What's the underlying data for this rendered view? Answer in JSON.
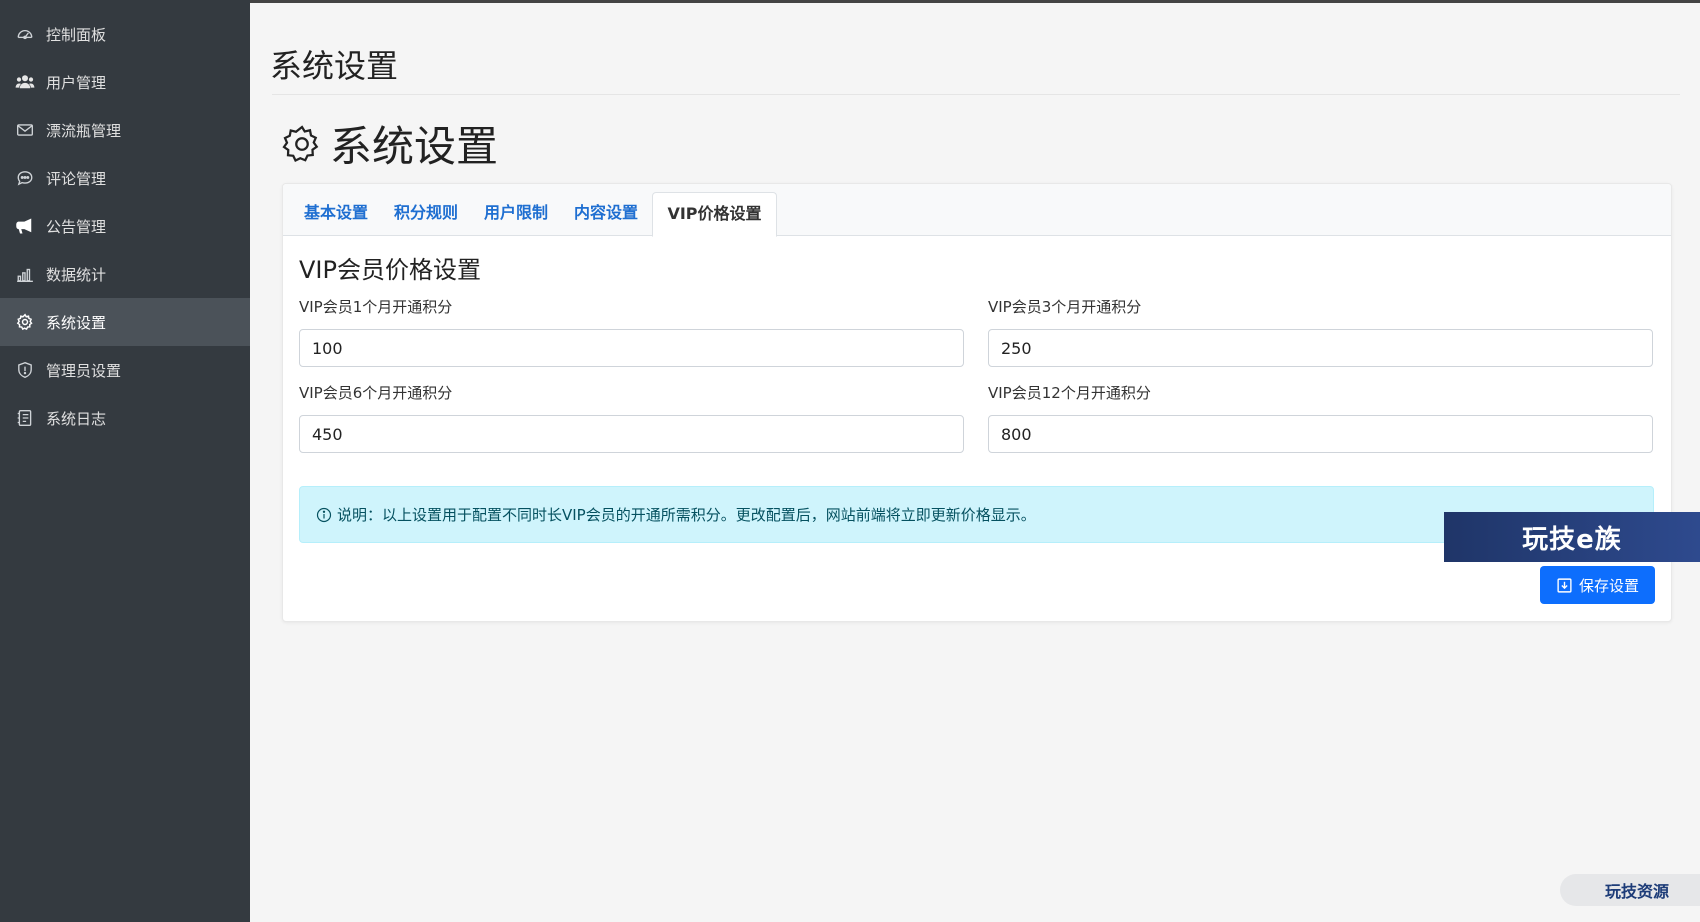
{
  "sidebar": {
    "items": [
      {
        "label": "控制面板",
        "icon": "speedometer-icon"
      },
      {
        "label": "用户管理",
        "icon": "users-icon"
      },
      {
        "label": "漂流瓶管理",
        "icon": "envelope-icon"
      },
      {
        "label": "评论管理",
        "icon": "chat-icon"
      },
      {
        "label": "公告管理",
        "icon": "megaphone-icon"
      },
      {
        "label": "数据统计",
        "icon": "bar-chart-icon"
      },
      {
        "label": "系统设置",
        "icon": "gear-icon",
        "active": true
      },
      {
        "label": "管理员设置",
        "icon": "shield-icon"
      },
      {
        "label": "系统日志",
        "icon": "journal-icon"
      }
    ]
  },
  "page": {
    "title": "系统设置",
    "heading": "系统设置"
  },
  "tabs": [
    {
      "label": "基本设置",
      "active": false
    },
    {
      "label": "积分规则",
      "active": false
    },
    {
      "label": "用户限制",
      "active": false
    },
    {
      "label": "内容设置",
      "active": false
    },
    {
      "label": "VIP价格设置",
      "active": true
    }
  ],
  "vip": {
    "section_title": "VIP会员价格设置",
    "fields": [
      {
        "label": "VIP会员1个月开通积分",
        "value": "100"
      },
      {
        "label": "VIP会员3个月开通积分",
        "value": "250"
      },
      {
        "label": "VIP会员6个月开通积分",
        "value": "450"
      },
      {
        "label": "VIP会员12个月开通积分",
        "value": "800"
      }
    ],
    "note": "说明：以上设置用于配置不同时长VIP会员的开通所需积分。更改配置后，网站前端将立即更新价格显示。",
    "save_label": "保存设置"
  },
  "watermarks": {
    "banner": "玩技e族",
    "pill": "玩技资源"
  },
  "colors": {
    "sidebar_bg": "#343a40",
    "sidebar_active": "#4b5259",
    "primary": "#0d6efd",
    "tab_link": "#1f6fd1",
    "alert_bg": "#cff4fc"
  }
}
